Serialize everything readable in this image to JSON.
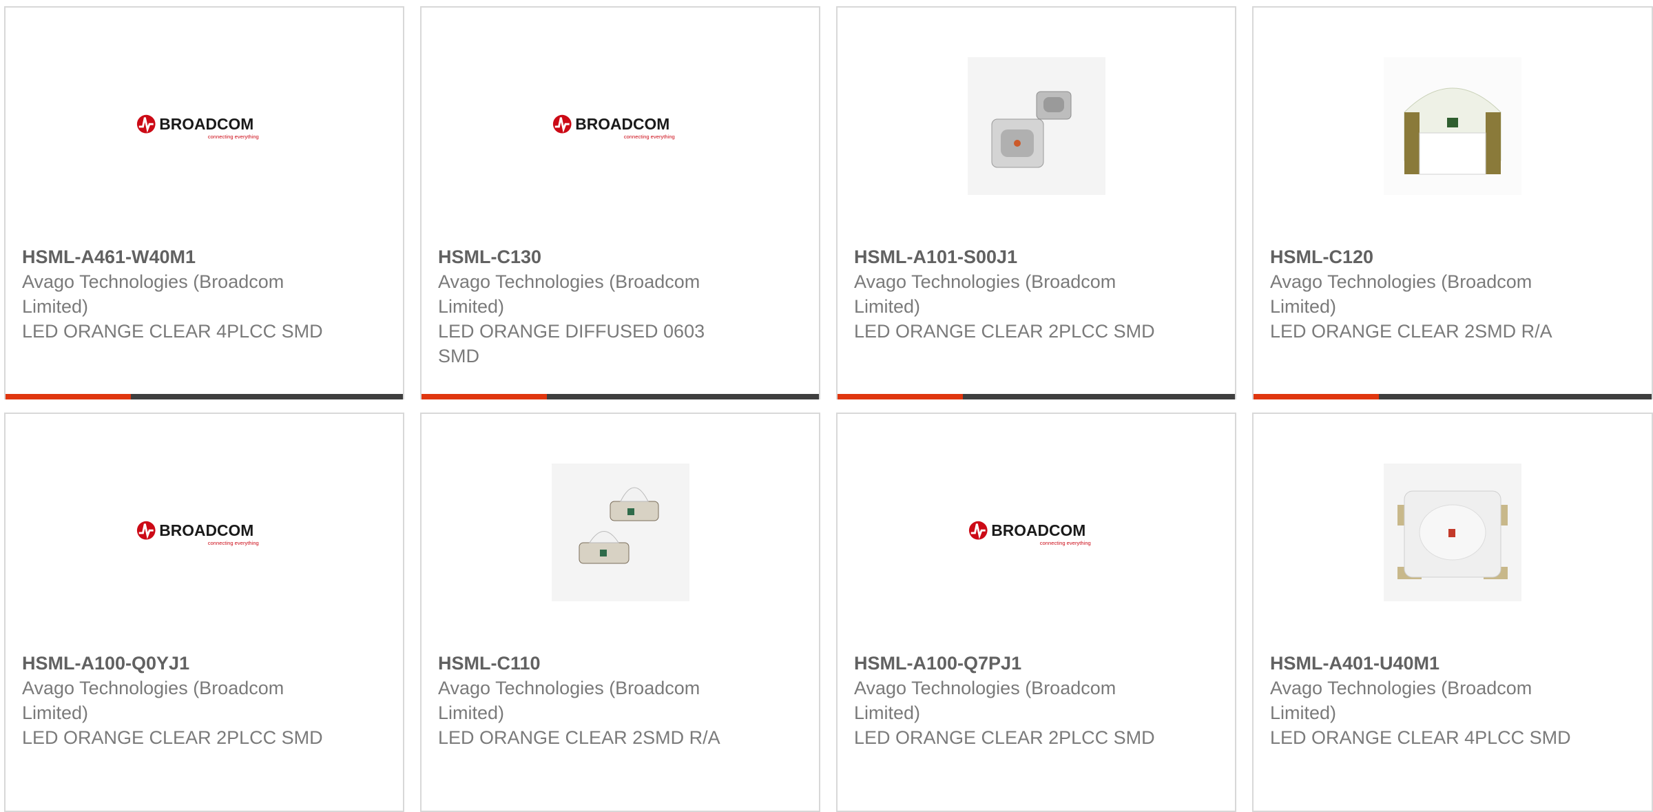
{
  "colors": {
    "accent": "#e0360f",
    "bar": "#3f3f3f",
    "border": "#d8d8d8",
    "brand_red": "#cc0000"
  },
  "brand_logo": {
    "name": "BROADCOM",
    "tagline": "connecting everything"
  },
  "cards": [
    {
      "part": "HSML-A461-W40M1",
      "manufacturer": "Avago Technologies (Broadcom Limited)",
      "description": "LED ORANGE CLEAR 4PLCC SMD",
      "image": "broadcom-logo"
    },
    {
      "part": "HSML-C130",
      "manufacturer": "Avago Technologies (Broadcom Limited)",
      "description": "LED ORANGE DIFFUSED 0603 SMD",
      "image": "broadcom-logo"
    },
    {
      "part": "HSML-A101-S00J1",
      "manufacturer": "Avago Technologies (Broadcom Limited)",
      "description": "LED ORANGE CLEAR 2PLCC SMD",
      "image": "led-2plcc-photo"
    },
    {
      "part": "HSML-C120",
      "manufacturer": "Avago Technologies (Broadcom Limited)",
      "description": "LED ORANGE CLEAR 2SMD R/A",
      "image": "led-right-angle-photo"
    },
    {
      "part": "HSML-A100-Q0YJ1",
      "manufacturer": "Avago Technologies (Broadcom Limited)",
      "description": "LED ORANGE CLEAR 2PLCC SMD",
      "image": "broadcom-logo"
    },
    {
      "part": "HSML-C110",
      "manufacturer": "Avago Technologies (Broadcom Limited)",
      "description": "LED ORANGE CLEAR 2SMD R/A",
      "image": "led-dome-photo"
    },
    {
      "part": "HSML-A100-Q7PJ1",
      "manufacturer": "Avago Technologies (Broadcom Limited)",
      "description": "LED ORANGE CLEAR 2PLCC SMD",
      "image": "broadcom-logo"
    },
    {
      "part": "HSML-A401-U40M1",
      "manufacturer": "Avago Technologies (Broadcom Limited)",
      "description": "LED ORANGE CLEAR 4PLCC SMD",
      "image": "led-4plcc-photo"
    }
  ]
}
